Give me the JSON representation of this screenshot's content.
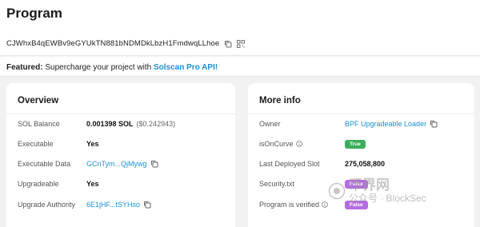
{
  "page": {
    "title": "Program",
    "address": "CJWhxB4qEWBv9eGYUkTN881bNDMDkLbzH1FmdwqLLhoe"
  },
  "featured": {
    "prefix": "Featured:",
    "text": " Supercharge your project with ",
    "link": "Solscan Pro API!"
  },
  "overview": {
    "title": "Overview",
    "rows": [
      {
        "label": "SOL Balance",
        "value": "0.001398 SOL",
        "sub": "($0.242943)"
      },
      {
        "label": "Executable",
        "value": "Yes"
      },
      {
        "label": "Executable Data",
        "value": "GCnTym...QjMywg"
      },
      {
        "label": "Upgradeable",
        "value": "Yes"
      },
      {
        "label": "Upgrade Authority",
        "value": "6E1jHF...tSYHso"
      }
    ]
  },
  "more_info": {
    "title": "More info",
    "rows": [
      {
        "label": "Owner",
        "value": "BPF Upgradeable Loader"
      },
      {
        "label": "isOnCurve",
        "badge": "True"
      },
      {
        "label": "Last Deployed Slot",
        "value": "275,058,800"
      },
      {
        "label": "Security.txt",
        "badge": "False"
      },
      {
        "label": "Program is verified",
        "badge": "False"
      }
    ]
  },
  "watermark": {
    "brand": "币界网",
    "account": "公众号 · BlockSec"
  },
  "colors": {
    "link": "#1d8fd8",
    "badge_true": "#3cae5a",
    "badge_false": "#b46de0"
  }
}
